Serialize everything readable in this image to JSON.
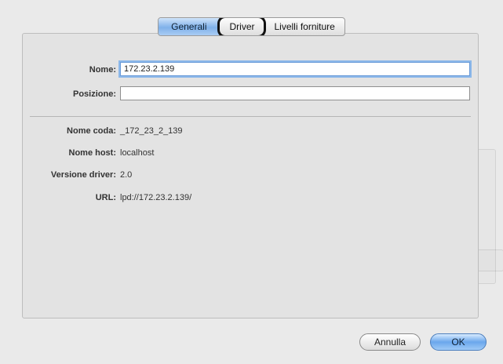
{
  "tabs": [
    {
      "label": "Generali"
    },
    {
      "label": "Driver"
    },
    {
      "label": "Livelli forniture"
    }
  ],
  "form": {
    "nome_label": "Nome:",
    "nome_value": "172.23.2.139",
    "posizione_label": "Posizione:",
    "posizione_value": ""
  },
  "info": {
    "nome_coda_label": "Nome coda:",
    "nome_coda_value": "_172_23_2_139",
    "nome_host_label": "Nome host:",
    "nome_host_value": "localhost",
    "versione_driver_label": "Versione driver:",
    "versione_driver_value": "2.0",
    "url_label": "URL:",
    "url_value": "lpd://172.23.2.139/"
  },
  "buttons": {
    "cancel_label": "Annulla",
    "ok_label": "OK"
  },
  "colors": {
    "accent": "#7fb1ea",
    "highlight_ring": "#111111"
  }
}
